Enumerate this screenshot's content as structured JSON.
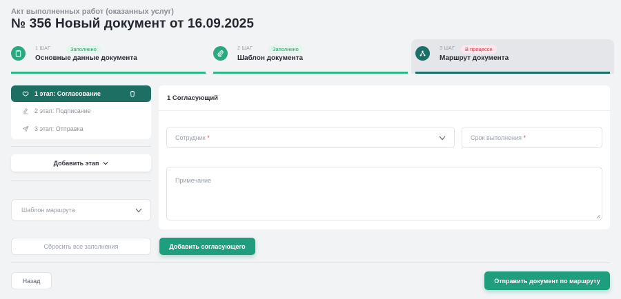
{
  "header": {
    "doc_kind": "Акт выполненных работ (оказанных услуг)",
    "title": "№ 356 Новый документ от 16.09.2025"
  },
  "steps": [
    {
      "num": "1 ШАГ",
      "status": "Заполнено",
      "label": "Основные данные документа",
      "icon": "clipboard-icon"
    },
    {
      "num": "2 ШАГ",
      "status": "Заполнено",
      "label": "Шаблон документа",
      "icon": "paperclip-icon"
    },
    {
      "num": "3 ШАГ",
      "status": "В процессе",
      "label": "Маршрут документа",
      "icon": "route-icon"
    }
  ],
  "stages": {
    "active": "1 этап: Согласование",
    "items": [
      "2 этап: Подписание",
      "3 этап: Отправка"
    ]
  },
  "left": {
    "add_stage": "Добавить этап",
    "route_template_placeholder": "Шаблон маршрута",
    "reset": "Сбросить все заполнения"
  },
  "card": {
    "title": "1 Согласующий",
    "employee_placeholder": "Сотрудник",
    "due_placeholder": "Срок выполнения",
    "required_mark": "*",
    "note_placeholder": "Примечание"
  },
  "actions": {
    "add_approver": "Добавить согласующего",
    "back": "Назад",
    "send": "Отправить документ по маршруту"
  },
  "colors": {
    "accent": "#1f9e7e",
    "dark_accent": "#1d6e63",
    "done_badge": "#2a9c6f",
    "progress_badge": "#d9344d"
  }
}
